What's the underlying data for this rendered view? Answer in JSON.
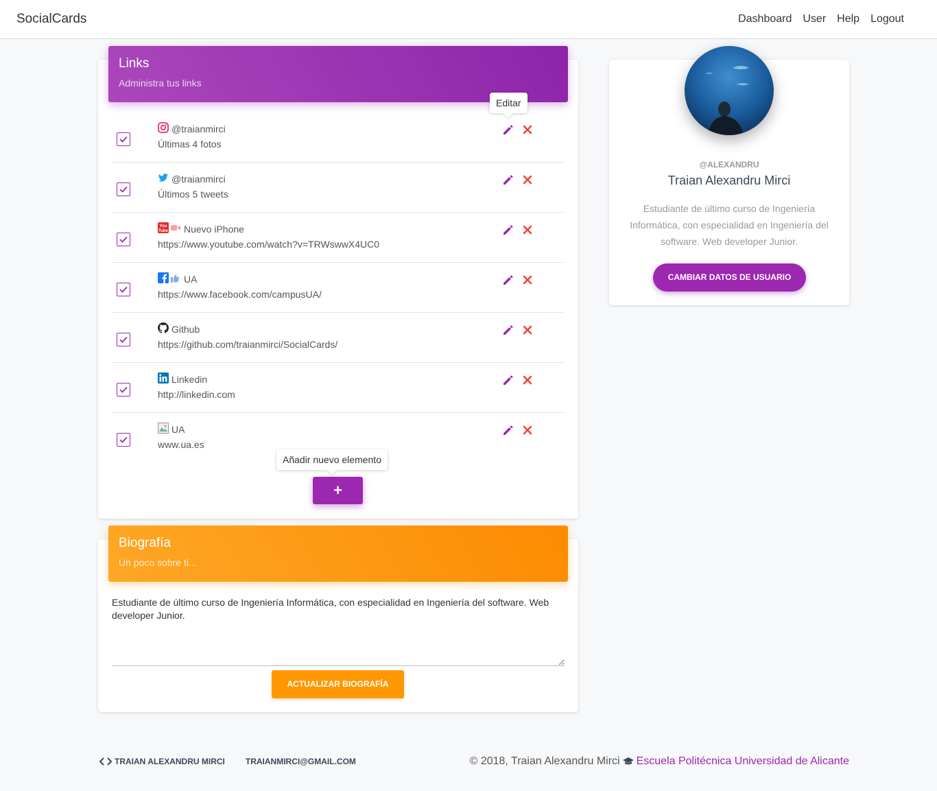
{
  "navbar": {
    "brand": "SocialCards",
    "links": [
      "Dashboard",
      "User",
      "Help",
      "Logout"
    ]
  },
  "links_card": {
    "title": "Links",
    "subtitle": "Administra tus links",
    "edit_tooltip": "Editar",
    "add_tooltip": "Añadir nuevo elemento",
    "add_label": "+",
    "items": [
      {
        "icon": "instagram-icon",
        "title": "@traianmirci",
        "detail": "Últimas 4 fotos",
        "checked": true
      },
      {
        "icon": "twitter-icon",
        "title": "@traianmirci",
        "detail": "Últimos 5 tweets",
        "checked": true
      },
      {
        "icon": "youtube-icon",
        "title": "Nuevo iPhone",
        "detail": "https://www.youtube.com/watch?v=TRWswwX4UC0",
        "checked": true
      },
      {
        "icon": "facebook-icon",
        "title": "UA",
        "detail": "https://www.facebook.com/campusUA/",
        "checked": true
      },
      {
        "icon": "github-icon",
        "title": "Github",
        "detail": "https://github.com/traianmirci/SocialCards/",
        "checked": true
      },
      {
        "icon": "linkedin-icon",
        "title": "Linkedin",
        "detail": "http://linkedin.com",
        "checked": true
      },
      {
        "icon": "web-image-icon",
        "title": "UA",
        "detail": "www.ua.es",
        "checked": true
      }
    ]
  },
  "bio_card": {
    "title": "Biografía",
    "subtitle": "Un poco sobre ti...",
    "text": "Estudiante de último curso de Ingeniería Informática, con especialidad en Ingeniería del software. Web developer Junior.",
    "button": "ACTUALIZAR BIOGRAFÍA"
  },
  "profile": {
    "handle": "@ALEXANDRU",
    "name": "Traian Alexandru Mirci",
    "description": "Estudiante de último curso de Ingeniería Informática, con especialidad en Ingeniería del software. Web developer Junior.",
    "button": "CAMBIAR DATOS DE USUARIO"
  },
  "footer": {
    "author": "TRAIAN ALEXANDRU MIRCI",
    "email": "TRAIANMIRCI@GMAIL.COM",
    "copyright": "© 2018, Traian Alexandru Mirci",
    "school": "Escuela Politécnica Universidad de Alicante"
  },
  "colors": {
    "primary": "#9c27b0",
    "warning": "#ff9800",
    "danger": "#f44336"
  }
}
